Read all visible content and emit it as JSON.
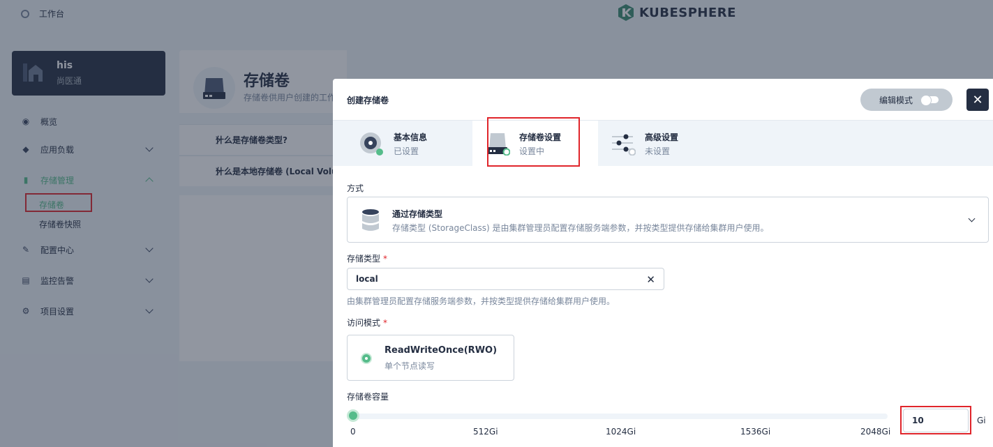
{
  "topbar": {
    "workbench": "工作台",
    "logo_text": "KUBESPHERE"
  },
  "workspace": {
    "name": "his",
    "sub": "尚医通"
  },
  "sidebar": {
    "items": [
      {
        "label": "概览",
        "icon": "overview-icon"
      },
      {
        "label": "应用负载",
        "icon": "workload-icon"
      },
      {
        "label": "存储管理",
        "icon": "storage-icon",
        "active": true
      },
      {
        "label": "配置中心",
        "icon": "config-icon"
      },
      {
        "label": "监控告警",
        "icon": "monitor-icon"
      },
      {
        "label": "项目设置",
        "icon": "settings-icon"
      }
    ],
    "sub_items": [
      {
        "label": "存储卷",
        "active": true
      },
      {
        "label": "存储卷快照"
      }
    ]
  },
  "page": {
    "title": "存储卷",
    "desc": "存储卷供用户创建的工作负载使用",
    "faq": [
      "什么是存储卷类型?",
      "什么是本地存储卷 (Local Volume)?"
    ]
  },
  "modal": {
    "title": "创建存储卷",
    "edit_mode": "编辑模式",
    "steps": [
      {
        "title": "基本信息",
        "status": "已设置"
      },
      {
        "title": "存储卷设置",
        "status": "设置中"
      },
      {
        "title": "高级设置",
        "status": "未设置"
      }
    ],
    "method": {
      "label": "方式",
      "name": "通过存储类型",
      "desc": "存储类型 (StorageClass) 是由集群管理员配置存储服务端参数，并按类型提供存储给集群用户使用。"
    },
    "storage_class": {
      "label": "存储类型",
      "required": "*",
      "value": "local",
      "hint": "由集群管理员配置存储服务端参数，并按类型提供存储给集群用户使用。"
    },
    "access_mode": {
      "label": "访问模式",
      "required": "*",
      "name": "ReadWriteOnce(RWO)",
      "desc": "单个节点读写"
    },
    "capacity": {
      "label": "存储卷容量",
      "ticks": [
        "0",
        "512Gi",
        "1024Gi",
        "1536Gi",
        "2048Gi"
      ],
      "value": "10",
      "unit": "Gi",
      "slider_fraction": 0
    }
  },
  "colors": {
    "accent": "#55bc8a",
    "dark": "#242e42",
    "highlight": "#e0252b"
  }
}
